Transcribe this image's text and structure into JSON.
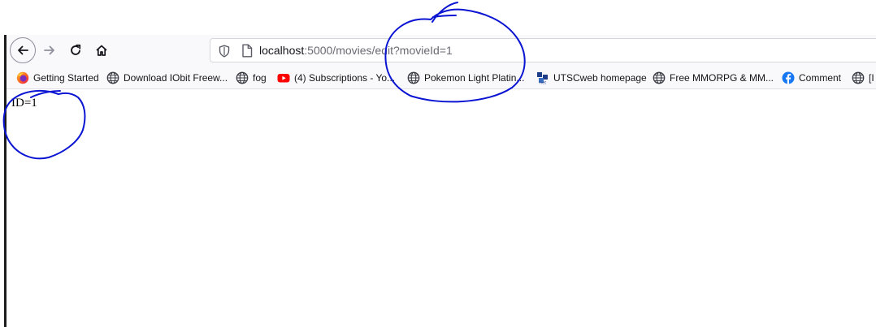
{
  "browser": {
    "url": {
      "host": "localhost",
      "rest": ":5000/movies/edit?movieId=1"
    },
    "nav_icons": {
      "back": "back-arrow-icon",
      "forward": "forward-arrow-icon",
      "reload": "reload-icon",
      "home": "home-icon"
    },
    "bookmarks": [
      {
        "label": "Getting Started",
        "icon": "firefox-icon"
      },
      {
        "label": "Download IObit Freew...",
        "icon": "globe-icon"
      },
      {
        "label": "fog",
        "icon": "globe-icon"
      },
      {
        "label": "(4) Subscriptions - Yo...",
        "icon": "youtube-icon"
      },
      {
        "label": "Pokemon Light Platin...",
        "icon": "globe-icon"
      },
      {
        "label": "UTSCweb homepage",
        "icon": "utsc-net-icon"
      },
      {
        "label": "Free MMORPG & MM...",
        "icon": "globe-icon"
      },
      {
        "label": "Comment",
        "icon": "facebook-icon"
      },
      {
        "label": "[I",
        "icon": "globe-icon"
      }
    ]
  },
  "content": {
    "id_text": "ID=1"
  },
  "annotations": {
    "color": "#0a14d2"
  }
}
